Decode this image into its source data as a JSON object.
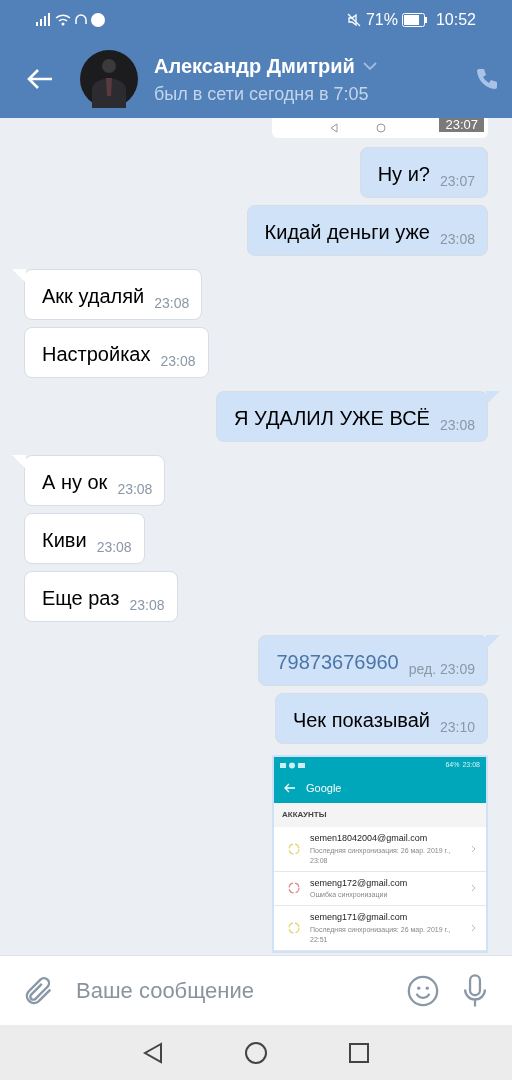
{
  "status_bar": {
    "battery": "71%",
    "time": "10:52"
  },
  "header": {
    "name": "Александр Дмитрий",
    "status": "был в сети сегодня в 7:05"
  },
  "top_partial": {
    "time": "23:07"
  },
  "messages": [
    {
      "kind": "text",
      "outgoing": true,
      "text": "Ну и?",
      "time": "23:07"
    },
    {
      "kind": "text",
      "outgoing": true,
      "text": "Кидай деньги уже",
      "time": "23:08"
    },
    {
      "kind": "text",
      "outgoing": false,
      "text": "Акк удаляй",
      "time": "23:08"
    },
    {
      "kind": "text",
      "outgoing": false,
      "text": "Настройках",
      "time": "23:08"
    },
    {
      "kind": "text",
      "outgoing": true,
      "text": "Я УДАЛИЛ УЖЕ ВСЁ",
      "time": "23:08"
    },
    {
      "kind": "text",
      "outgoing": false,
      "text": "А ну ок",
      "time": "23:08"
    },
    {
      "kind": "text",
      "outgoing": false,
      "text": "Киви",
      "time": "23:08"
    },
    {
      "kind": "text",
      "outgoing": false,
      "text": "Еще раз",
      "time": "23:08"
    },
    {
      "kind": "link",
      "outgoing": true,
      "text": "79873676960",
      "time": "ред. 23:09"
    },
    {
      "kind": "text",
      "outgoing": true,
      "text": "Чек показывай",
      "time": "23:10"
    },
    {
      "kind": "screenshot",
      "outgoing": true,
      "screen": {
        "battery": "64%",
        "time": "23:08",
        "title": "Google",
        "section": "АККАУНТЫ",
        "accounts": [
          {
            "email": "semen18042004@gmail.com",
            "status": "Последняя синхронизация: 26 мар. 2019 г., 23:08",
            "color": "#e3d36b"
          },
          {
            "email": "semeng172@gmail.com",
            "status": "Ошибка синхронизации",
            "color": "#d98a8a"
          },
          {
            "email": "semeng171@gmail.com",
            "status": "Последняя синхронизация: 26 мар. 2019 г., 22:51",
            "color": "#e3d36b"
          }
        ]
      }
    }
  ],
  "composer": {
    "placeholder": "Ваше сообщение"
  }
}
